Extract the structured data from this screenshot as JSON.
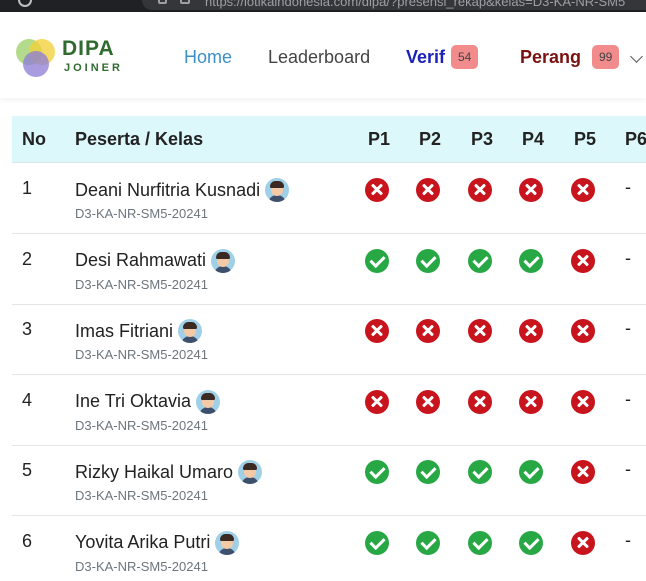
{
  "browser": {
    "url": "https://iotikaindonesia.com/dipa/?presensi_rekap&kelas=D3-KA-NR-SM5"
  },
  "brand": {
    "title": "DIPA",
    "subtitle": "JOINER"
  },
  "nav": {
    "home": "Home",
    "leaderboard": "Leaderboard",
    "verif": "Verif",
    "verif_count": "54",
    "perang": "Perang",
    "perang_count": "99"
  },
  "colors": {
    "present": "#28a745",
    "absent": "#c8141c",
    "header_bg": "#ddf8fb",
    "badge_bg": "#f28b8b"
  },
  "table": {
    "headers": [
      "No",
      "Peserta / Kelas",
      "P1",
      "P2",
      "P3",
      "P4",
      "P5",
      "P6"
    ],
    "empty_mark": "-",
    "rows": [
      {
        "no": "1",
        "name": "Deani Nurfitria Kusnadi",
        "kelas": "D3-KA-NR-SM5-20241",
        "status": [
          "absent",
          "absent",
          "absent",
          "absent",
          "absent"
        ]
      },
      {
        "no": "2",
        "name": "Desi Rahmawati",
        "kelas": "D3-KA-NR-SM5-20241",
        "status": [
          "present",
          "present",
          "present",
          "present",
          "absent"
        ]
      },
      {
        "no": "3",
        "name": "Imas Fitriani",
        "kelas": "D3-KA-NR-SM5-20241",
        "status": [
          "absent",
          "absent",
          "absent",
          "absent",
          "absent"
        ]
      },
      {
        "no": "4",
        "name": "Ine Tri Oktavia",
        "kelas": "D3-KA-NR-SM5-20241",
        "status": [
          "absent",
          "absent",
          "absent",
          "absent",
          "absent"
        ]
      },
      {
        "no": "5",
        "name": "Rizky Haikal Umaro",
        "kelas": "D3-KA-NR-SM5-20241",
        "status": [
          "present",
          "present",
          "present",
          "present",
          "absent"
        ]
      },
      {
        "no": "6",
        "name": "Yovita Arika Putri",
        "kelas": "D3-KA-NR-SM5-20241",
        "status": [
          "present",
          "present",
          "present",
          "present",
          "absent"
        ]
      }
    ]
  }
}
